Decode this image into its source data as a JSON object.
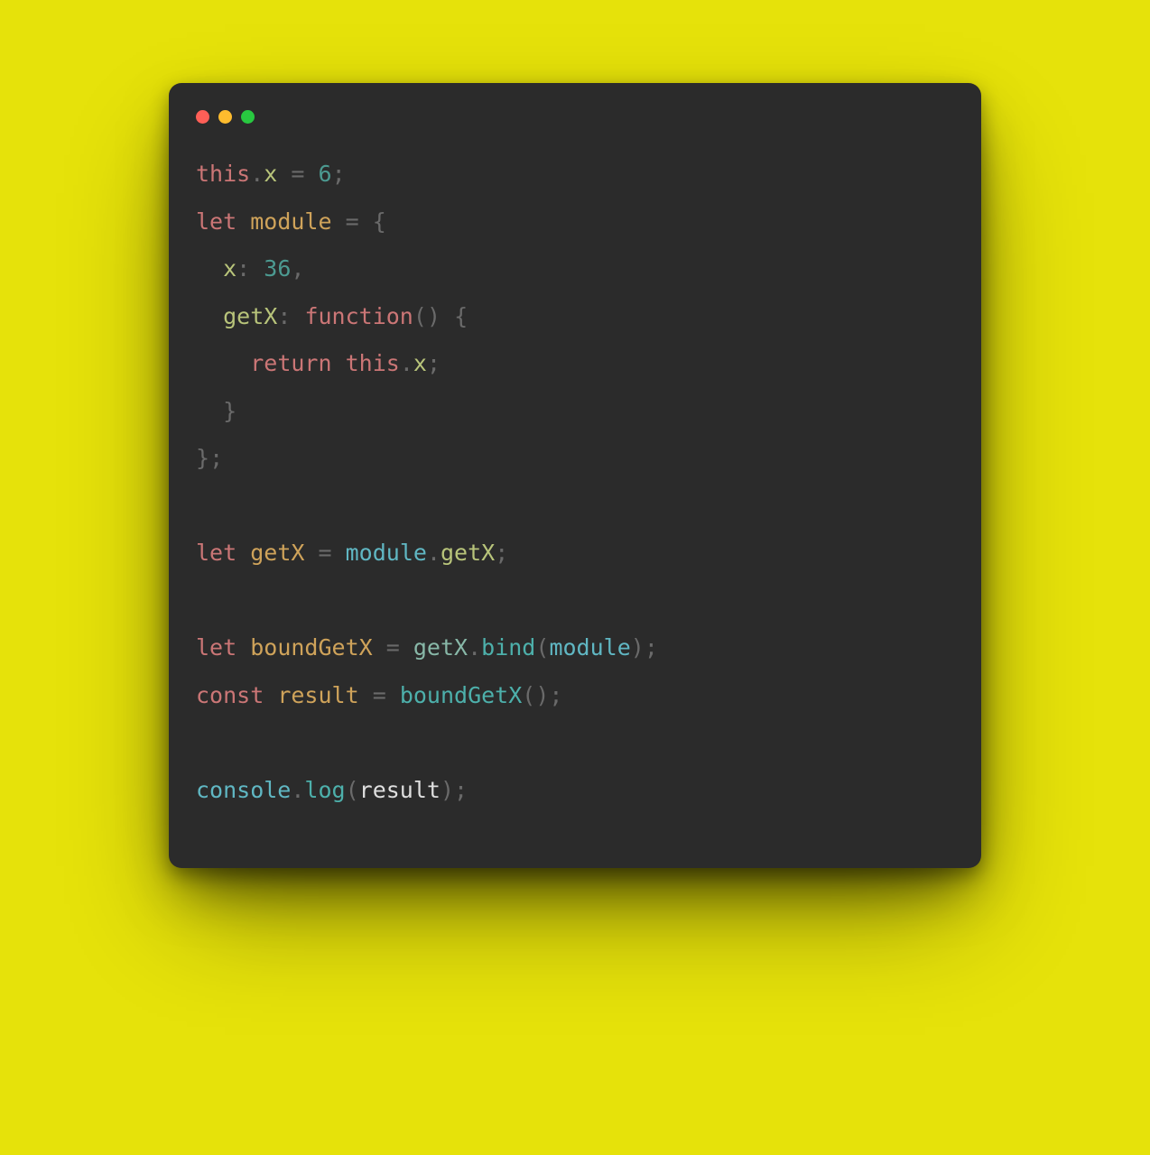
{
  "window": {
    "traffic_lights": [
      "close",
      "minimize",
      "maximize"
    ]
  },
  "code": {
    "tokens": [
      [
        {
          "t": "this",
          "c": "tok-kw"
        },
        {
          "t": ".",
          "c": "tok-punc"
        },
        {
          "t": "x",
          "c": "tok-prop"
        },
        {
          "t": " ",
          "c": ""
        },
        {
          "t": "=",
          "c": "tok-punc"
        },
        {
          "t": " ",
          "c": ""
        },
        {
          "t": "6",
          "c": "tok-num"
        },
        {
          "t": ";",
          "c": "tok-punc"
        }
      ],
      [
        {
          "t": "let",
          "c": "tok-kw"
        },
        {
          "t": " ",
          "c": ""
        },
        {
          "t": "module",
          "c": "tok-var"
        },
        {
          "t": " ",
          "c": ""
        },
        {
          "t": "=",
          "c": "tok-punc"
        },
        {
          "t": " ",
          "c": ""
        },
        {
          "t": "{",
          "c": "tok-punc"
        }
      ],
      [
        {
          "t": "  ",
          "c": ""
        },
        {
          "t": "x",
          "c": "tok-prop"
        },
        {
          "t": ":",
          "c": "tok-punc"
        },
        {
          "t": " ",
          "c": ""
        },
        {
          "t": "36",
          "c": "tok-num"
        },
        {
          "t": ",",
          "c": "tok-punc"
        }
      ],
      [
        {
          "t": "  ",
          "c": ""
        },
        {
          "t": "getX",
          "c": "tok-prop"
        },
        {
          "t": ":",
          "c": "tok-punc"
        },
        {
          "t": " ",
          "c": ""
        },
        {
          "t": "function",
          "c": "tok-fnword"
        },
        {
          "t": "(",
          "c": "tok-punc"
        },
        {
          "t": ")",
          "c": "tok-punc"
        },
        {
          "t": " ",
          "c": ""
        },
        {
          "t": "{",
          "c": "tok-punc"
        }
      ],
      [
        {
          "t": "    ",
          "c": ""
        },
        {
          "t": "return",
          "c": "tok-kw"
        },
        {
          "t": " ",
          "c": ""
        },
        {
          "t": "this",
          "c": "tok-kw"
        },
        {
          "t": ".",
          "c": "tok-punc"
        },
        {
          "t": "x",
          "c": "tok-prop"
        },
        {
          "t": ";",
          "c": "tok-punc"
        }
      ],
      [
        {
          "t": "  ",
          "c": ""
        },
        {
          "t": "}",
          "c": "tok-punc"
        }
      ],
      [
        {
          "t": "}",
          "c": "tok-punc"
        },
        {
          "t": ";",
          "c": "tok-punc"
        }
      ],
      [],
      [
        {
          "t": "let",
          "c": "tok-kw"
        },
        {
          "t": " ",
          "c": ""
        },
        {
          "t": "getX",
          "c": "tok-var"
        },
        {
          "t": " ",
          "c": ""
        },
        {
          "t": "=",
          "c": "tok-punc"
        },
        {
          "t": " ",
          "c": ""
        },
        {
          "t": "module",
          "c": "tok-obj"
        },
        {
          "t": ".",
          "c": "tok-punc"
        },
        {
          "t": "getX",
          "c": "tok-prop"
        },
        {
          "t": ";",
          "c": "tok-punc"
        }
      ],
      [],
      [
        {
          "t": "let",
          "c": "tok-kw"
        },
        {
          "t": " ",
          "c": ""
        },
        {
          "t": "boundGetX",
          "c": "tok-var"
        },
        {
          "t": " ",
          "c": ""
        },
        {
          "t": "=",
          "c": "tok-punc"
        },
        {
          "t": " ",
          "c": ""
        },
        {
          "t": "getX",
          "c": "tok-fnname"
        },
        {
          "t": ".",
          "c": "tok-punc"
        },
        {
          "t": "bind",
          "c": "tok-call"
        },
        {
          "t": "(",
          "c": "tok-punc"
        },
        {
          "t": "module",
          "c": "tok-obj"
        },
        {
          "t": ")",
          "c": "tok-punc"
        },
        {
          "t": ";",
          "c": "tok-punc"
        }
      ],
      [
        {
          "t": "const",
          "c": "tok-kw"
        },
        {
          "t": " ",
          "c": ""
        },
        {
          "t": "result",
          "c": "tok-var"
        },
        {
          "t": " ",
          "c": ""
        },
        {
          "t": "=",
          "c": "tok-punc"
        },
        {
          "t": " ",
          "c": ""
        },
        {
          "t": "boundGetX",
          "c": "tok-call"
        },
        {
          "t": "(",
          "c": "tok-punc"
        },
        {
          "t": ")",
          "c": "tok-punc"
        },
        {
          "t": ";",
          "c": "tok-punc"
        }
      ],
      [],
      [
        {
          "t": "console",
          "c": "tok-obj"
        },
        {
          "t": ".",
          "c": "tok-punc"
        },
        {
          "t": "log",
          "c": "tok-call"
        },
        {
          "t": "(",
          "c": "tok-punc"
        },
        {
          "t": "result",
          "c": "tok-ident"
        },
        {
          "t": ")",
          "c": "tok-punc"
        },
        {
          "t": ";",
          "c": "tok-punc"
        }
      ]
    ]
  },
  "colors": {
    "background_outer": "#e6e20a",
    "background_window": "#2b2b2b"
  }
}
